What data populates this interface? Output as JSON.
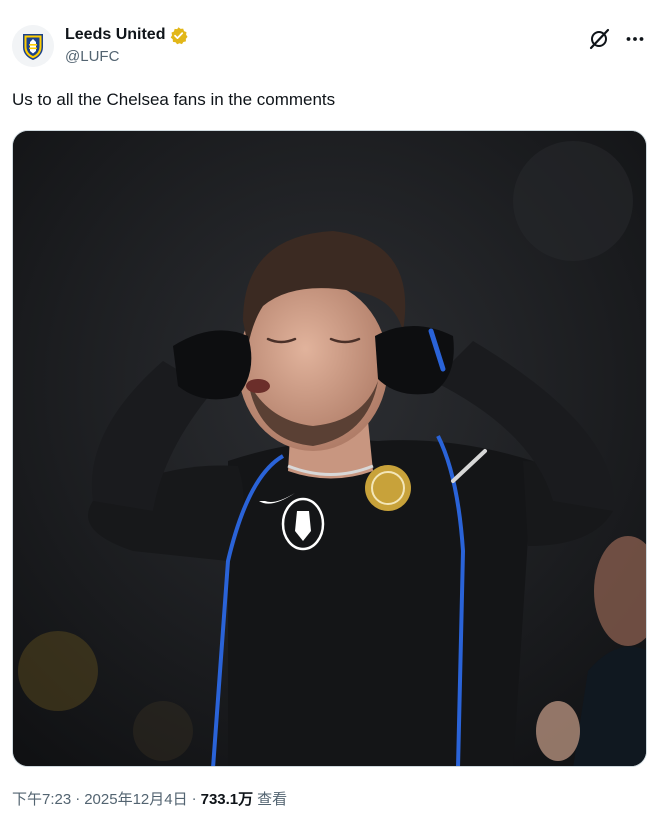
{
  "account": {
    "name": "Leeds United",
    "handle": "@LUFC",
    "verified": true,
    "badge_color": "#e2b719"
  },
  "icons": {
    "grok": "grok-slash-icon",
    "more": "more-dots-icon"
  },
  "post": {
    "text": "Us to all the Chelsea fans in the comments",
    "media_alt": "Chelsea player in black long-sleeve kit covering his ears with gloved hands, eyes closed"
  },
  "meta": {
    "time": "下午7:23",
    "sep1": "·",
    "date": "2025年12月4日",
    "sep2": "·",
    "views_count": "733.1万",
    "views_label": "查看"
  },
  "colors": {
    "text": "#0f1419",
    "secondary": "#536471",
    "kit": "#141517",
    "kit_trim": "#2a63d8",
    "crest_gold": "#c8a23a"
  }
}
